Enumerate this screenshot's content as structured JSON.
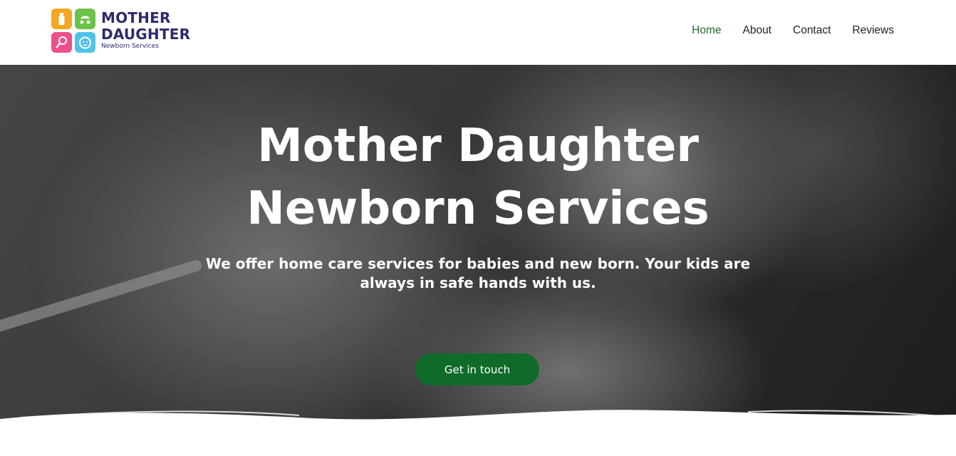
{
  "brand": {
    "line1": "MOTHER",
    "line2": "DAUGHTER",
    "tagline": "Newborn Services",
    "tile_colors": [
      "#f5a623",
      "#6cc24a",
      "#ec4f8a",
      "#4fc3e8"
    ],
    "tile_icons": [
      "bottle-icon",
      "stroller-icon",
      "rattle-icon",
      "baby-face-icon"
    ]
  },
  "nav": {
    "items": [
      {
        "label": "Home",
        "active": true
      },
      {
        "label": "About",
        "active": false
      },
      {
        "label": "Contact",
        "active": false
      },
      {
        "label": "Reviews",
        "active": false
      }
    ],
    "active_color": "#1e6b2c"
  },
  "hero": {
    "title_line1": "Mother Daughter",
    "title_line2": "Newborn Services",
    "description": "We offer home care services for babies and new born. Your kids are always in safe hands with us.",
    "cta_label": "Get in touch",
    "cta_color": "#0f6b2a"
  }
}
